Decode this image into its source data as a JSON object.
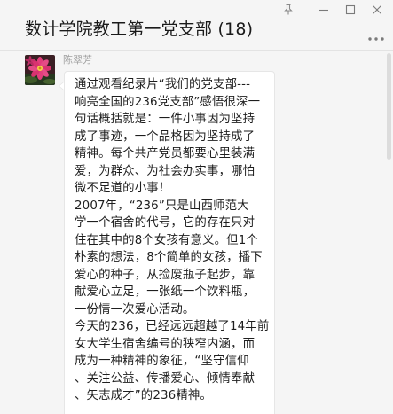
{
  "window": {
    "title": "数计学院教工第一党支部 (18)"
  },
  "controls": {
    "pin_icon": "pin-icon",
    "minimize_icon": "minimize-icon",
    "maximize_icon": "maximize-icon",
    "close_icon": "close-icon",
    "more_icon": "more-dots-icon"
  },
  "message": {
    "sender": "陈翠芳",
    "avatar_icon": "flower-avatar",
    "lines": [
      "通过观看纪录片“我们的党支部---",
      "响亮全国的236党支部”感悟很深一",
      "句话概括就是：一件小事因为坚持",
      "成了事迹，一个品格因为坚持成了",
      "精神。每个共产党员都要心里装满",
      "爱，为群众、为社会办实事，哪怕",
      "微不足道的小事！",
      "2007年，“236”只是山西师范大",
      "学一个宿舍的代号，它的存在只对",
      "住在其中的8个女孩有意义。但1个",
      "朴素的想法，8个简单的女孩，播下",
      "爱心的种子，从捡废瓶子起步，靠",
      "献爱心立足，一张纸一个饮料瓶，",
      "一份情一次爱心活动。",
      "今天的236，已经远远超越了14年前",
      "女大学生宿舍编号的狭窄内涵，而",
      "成为一种精神的象征，“坚守信仰",
      "、关注公益、传播爱心、倾情奉献",
      "、矢志成才”的236精神。"
    ]
  },
  "colors": {
    "background": "#f5f5f5",
    "bubble": "#ffffff",
    "text": "#1e1e1e",
    "sender": "#a0a0a0"
  }
}
